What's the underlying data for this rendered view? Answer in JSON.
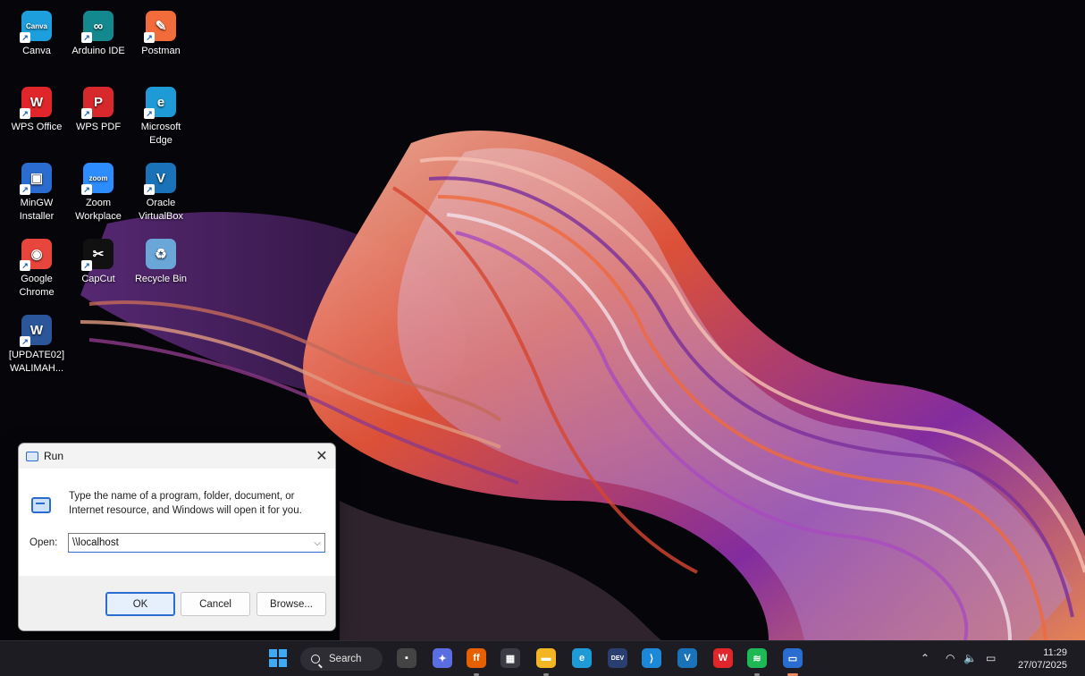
{
  "desktop": {
    "icons": [
      {
        "label": "Canva",
        "glyph": "Canva",
        "color": "#1c9fdc"
      },
      {
        "label": "Arduino IDE",
        "glyph": "∞",
        "color": "#13898f"
      },
      {
        "label": "Postman",
        "glyph": "✎",
        "color": "#f26b3a"
      },
      {
        "label": "WPS Office",
        "glyph": "W",
        "color": "#e0262a"
      },
      {
        "label": "WPS PDF",
        "glyph": "P",
        "color": "#d7282c"
      },
      {
        "label": "Microsoft Edge",
        "glyph": "e",
        "color": "#1e9bd7"
      },
      {
        "label": "MinGW Installer",
        "glyph": "▣",
        "color": "#2b6cd0"
      },
      {
        "label": "Zoom Workplace",
        "glyph": "zoom",
        "color": "#2d8cff"
      },
      {
        "label": "Oracle VirtualBox",
        "glyph": "V",
        "color": "#1a73b8"
      },
      {
        "label": "Google Chrome",
        "glyph": "◉",
        "color": "#e8453c"
      },
      {
        "label": "CapCut",
        "glyph": "✂",
        "color": "#111111"
      },
      {
        "label": "Recycle Bin",
        "glyph": "♻",
        "color": "#6aa6d8"
      },
      {
        "label": "[UPDATE02] WALIMAH...",
        "glyph": "W",
        "color": "#2b579a"
      }
    ]
  },
  "run_dialog": {
    "title": "Run",
    "close_glyph": "✕",
    "description": "Type the name of a program, folder, document, or Internet resource, and Windows will open it for you.",
    "open_label": "Open:",
    "open_value": "\\\\localhost",
    "dropdown_glyph": "⌵",
    "buttons": {
      "ok": "OK",
      "cancel": "Cancel",
      "browse": "Browse..."
    }
  },
  "taskbar": {
    "search_label": "Search",
    "apps": [
      {
        "name": "task-view",
        "glyph": "▪",
        "color": "#444"
      },
      {
        "name": "copilot",
        "glyph": "✦",
        "color": "#5b6ee1"
      },
      {
        "name": "firefox",
        "glyph": "ff",
        "color": "#e66000"
      },
      {
        "name": "microsoft-store",
        "glyph": "▦",
        "color": "#3b3b44"
      },
      {
        "name": "file-explorer",
        "glyph": "▬",
        "color": "#f2b622"
      },
      {
        "name": "edge",
        "glyph": "e",
        "color": "#1e9bd7"
      },
      {
        "name": "dev-home",
        "glyph": "DEV",
        "color": "#2a3f6f"
      },
      {
        "name": "vscode",
        "glyph": "⟩",
        "color": "#1e88d8"
      },
      {
        "name": "virtualbox",
        "glyph": "V",
        "color": "#1a73b8"
      },
      {
        "name": "wps",
        "glyph": "W",
        "color": "#e0262a"
      },
      {
        "name": "spotify",
        "glyph": "≋",
        "color": "#1db954"
      },
      {
        "name": "run",
        "glyph": "▭",
        "color": "#2b6cd0"
      }
    ],
    "tray": {
      "chevron": "⌃",
      "wifi": "◠",
      "volume": "🔈",
      "battery": "▭"
    },
    "time": "11:29",
    "date": "27/07/2025"
  }
}
